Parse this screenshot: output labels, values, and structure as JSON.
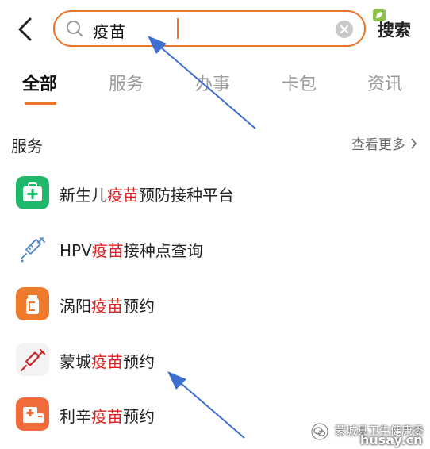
{
  "search": {
    "query": "疫苗",
    "button_label": "搜索"
  },
  "tabs": [
    {
      "label": "全部",
      "active": true
    },
    {
      "label": "服务",
      "active": false
    },
    {
      "label": "办事",
      "active": false
    },
    {
      "label": "卡包",
      "active": false
    },
    {
      "label": "资讯",
      "active": false
    }
  ],
  "section": {
    "title": "服务",
    "more_label": "查看更多"
  },
  "results": [
    {
      "prefix": "新生儿",
      "highlight": "疫苗",
      "suffix": "预防接种平台",
      "icon": "medical-kit-icon"
    },
    {
      "prefix": "HPV",
      "highlight": "疫苗",
      "suffix": "接种点查询",
      "icon": "syringe-outline-icon"
    },
    {
      "prefix": "涡阳",
      "highlight": "疫苗",
      "suffix": "预约",
      "icon": "vaccine-vial-icon"
    },
    {
      "prefix": "蒙城",
      "highlight": "疫苗",
      "suffix": "预约",
      "icon": "syringe-icon"
    },
    {
      "prefix": "利辛",
      "highlight": "疫苗",
      "suffix": "预约",
      "icon": "hospital-icon"
    }
  ],
  "watermark": {
    "account": "蒙城县卫生健康委",
    "site": "husay.cn"
  },
  "colors": {
    "accent": "#e8752c",
    "highlight": "#e02020",
    "arrow": "#3f6fd1"
  }
}
